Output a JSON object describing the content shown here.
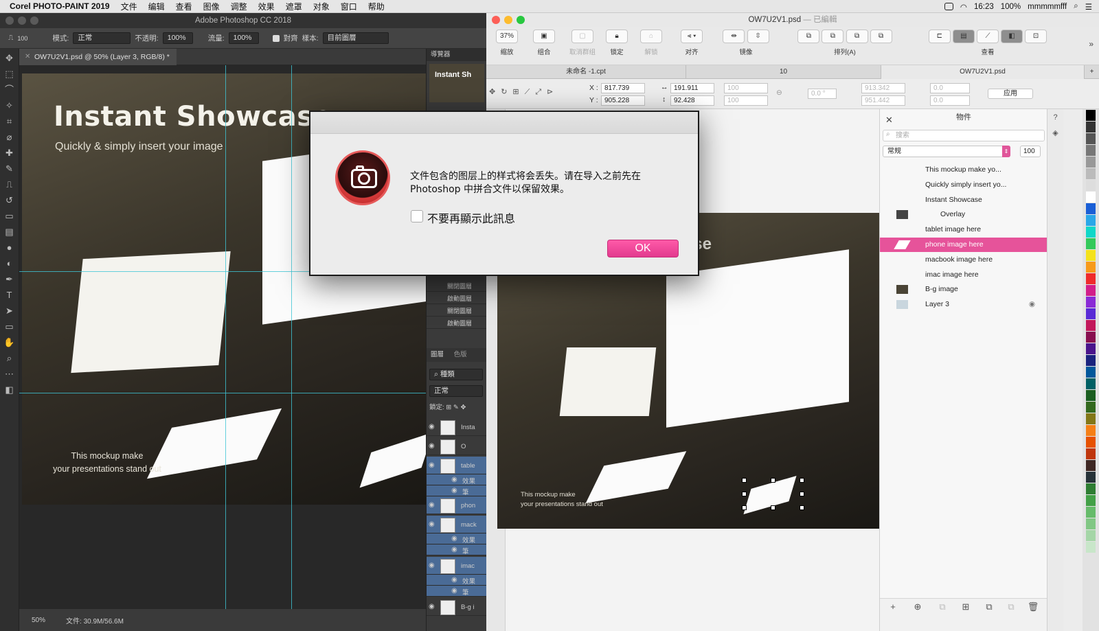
{
  "menubar": {
    "app_name": "Corel PHOTO-PAINT 2019",
    "items": [
      "文件",
      "编辑",
      "查看",
      "图像",
      "调整",
      "效果",
      "遮罩",
      "对象",
      "窗口",
      "帮助"
    ],
    "time": "16:23",
    "battery": "100%",
    "user": "mmmmmfff"
  },
  "ps": {
    "window_title": "Adobe Photoshop CC 2018",
    "brush_size": "100",
    "mode_label": "模式:",
    "mode_value": "正常",
    "opacity_label": "不透明:",
    "opacity_value": "100%",
    "flow_label": "流量:",
    "flow_value": "100%",
    "align_label": "對齊",
    "sample_label": "樣本:",
    "sample_value": "目前圖層",
    "doc_tab": "OW7U2V1.psd @ 50% (Layer 3, RGB/8) *",
    "hero_title": "Instant Showcase",
    "hero_sub": "Quickly & simply insert your image",
    "mockup_line1": "This mockup make",
    "mockup_line2": "your presentations  stand out",
    "zoom": "50%",
    "file_info": "文件: 30.9M/56.6M",
    "navigator_label": "導覽器",
    "nav_thumb_text": "Instant Sh",
    "actions": [
      "關閉圖層",
      "啟動圖層",
      "關閉圖層",
      "啟動圖層"
    ],
    "layers_tab": "圖層",
    "channels_tab": "色版",
    "kind_label": "種類",
    "blend_value": "正常",
    "lock_label": "鎖定:",
    "layers": [
      {
        "name": "Insta"
      },
      {
        "name": "O"
      },
      {
        "name": "table"
      },
      {
        "name": "效果"
      },
      {
        "name": "筆"
      },
      {
        "name": "phon"
      },
      {
        "name": "mack"
      },
      {
        "name": "效果"
      },
      {
        "name": "筆"
      },
      {
        "name": "imac"
      },
      {
        "name": "效果"
      },
      {
        "name": "筆"
      },
      {
        "name": "B-g i"
      }
    ]
  },
  "cd": {
    "doc_title": "OW7U2V1.psd",
    "doc_state": "— 已編輯",
    "zoom": "37%",
    "toolbar": [
      {
        "label": "缩放"
      },
      {
        "label": "组合"
      },
      {
        "label": "取消群组"
      },
      {
        "label": "锁定"
      },
      {
        "label": "解锁"
      },
      {
        "label": "对齐"
      },
      {
        "label": "镜像"
      },
      {
        "label": "排列(A)"
      },
      {
        "label": "查看"
      }
    ],
    "tabs": [
      "未命名 -1.cpt",
      "10",
      "OW7U2V1.psd"
    ],
    "x_label": "X :",
    "x_value": "817.739",
    "y_label": "Y :",
    "y_value": "905.228",
    "w_value": "191.911",
    "h_value": "92.428",
    "sx": "100",
    "sy": "100",
    "angle": "0.0 °",
    "cx": "913.342",
    "cy": "951.442",
    "skew_x": "0.0",
    "skew_y": "0.0",
    "apply_label": "应用",
    "canvas_title_fragment": "se",
    "mockup_line1": "This mockup make",
    "mockup_line2": "your presentations  stand out"
  },
  "objects": {
    "title": "物件",
    "search_placeholder": "搜索",
    "mode_value": "常规",
    "opacity_value": "100",
    "rows": [
      {
        "name": "This mockup make  yo..."
      },
      {
        "name": "Quickly  simply insert yo..."
      },
      {
        "name": "Instant Showcase"
      },
      {
        "name": "Overlay"
      },
      {
        "name": "tablet image here"
      },
      {
        "name": "phone image here"
      },
      {
        "name": "macbook image here"
      },
      {
        "name": "imac image here"
      },
      {
        "name": "B-g image"
      },
      {
        "name": "Layer 3"
      }
    ],
    "selected_index": 5
  },
  "dialog": {
    "message": "文件包含的图层上的样式将会丢失。请在导入之前先在 Photoshop 中拼合文件以保留效果。",
    "checkbox_label": "不要再顯示此訊息",
    "ok_label": "OK",
    "accent_color": "#e6539a"
  },
  "icons": [
    "camera-icon",
    "search-icon",
    "eye-icon",
    "close-icon",
    "move-icon",
    "zoom-icon"
  ]
}
